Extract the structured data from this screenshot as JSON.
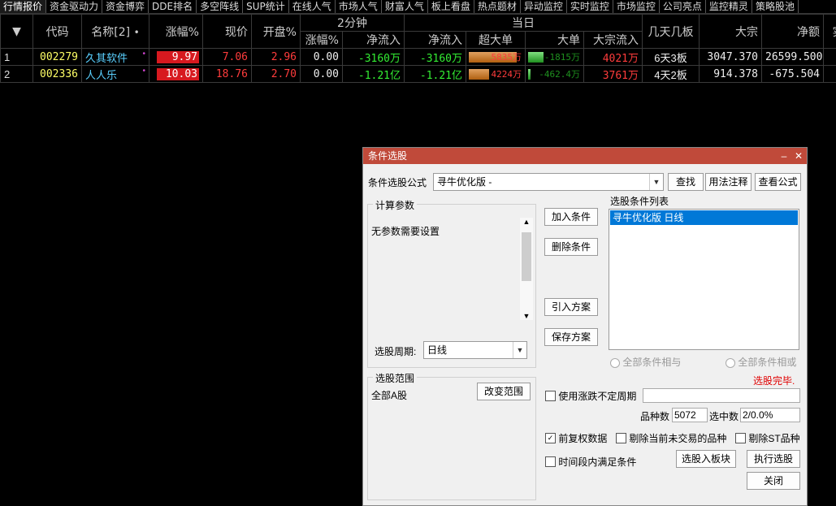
{
  "tabs": [
    "行情报价",
    "资金驱动力",
    "资金博弈",
    "DDE排名",
    "多空阵线",
    "SUP统计",
    "在线人气",
    "市场人气",
    "财富人气",
    "板上看盘",
    "热点题材",
    "异动监控",
    "实时监控",
    "市场监控",
    "公司亮点",
    "监控精灵",
    "策略股池"
  ],
  "header": {
    "code": "代码",
    "name": "名称[2]",
    "change_pct": "涨幅%",
    "price": "现价",
    "open_pct": "开盘%",
    "two_min": "2分钟",
    "two_min_change": "涨幅%",
    "two_min_inflow": "净流入",
    "today": "当日",
    "today_inflow": "净流入",
    "super_large": "超大单",
    "large": "大单",
    "bulk_inflow": "大宗流入",
    "boards": "几天几板",
    "block": "大宗",
    "net_amount": "净额",
    "extra": "实"
  },
  "rows": [
    {
      "idx": "1",
      "code": "002279",
      "name": "久其软件",
      "change": "9.97",
      "price": "7.06",
      "open": "2.96",
      "m2chg": "0.00",
      "m2in": "-3160万",
      "din": "-3160万",
      "super": "5835万",
      "super_ratio": 0.95,
      "large": "-1815万",
      "large_ratio": 0.3,
      "bulk": "4021万",
      "boards": "6天3板",
      "block": "3047.370",
      "net": "26599.500"
    },
    {
      "idx": "2",
      "code": "002336",
      "name": "人人乐",
      "change": "10.03",
      "price": "18.76",
      "open": "2.70",
      "m2chg": "0.00",
      "m2in": "-1.21亿",
      "din": "-1.21亿",
      "super": "4224万",
      "super_ratio": 0.4,
      "large": "-462.4万",
      "large_ratio": 0.05,
      "bulk": "3761万",
      "boards": "4天2板",
      "block": "914.378",
      "net": "-675.504"
    }
  ],
  "dialog": {
    "title": "条件选股",
    "formula_label": "条件选股公式",
    "formula_value": "寻牛优化版  -",
    "btn_find": "查找",
    "btn_usage": "用法注释",
    "btn_view": "查看公式",
    "params_caption": "计算参数",
    "params_text": "无参数需要设置",
    "period_label": "选股周期:",
    "period_value": "日线",
    "btn_add": "加入条件",
    "btn_delete": "删除条件",
    "btn_import": "引入方案",
    "btn_save": "保存方案",
    "list_caption": "选股条件列表",
    "list_item": "寻牛优化版  日线",
    "radio_and": "全部条件相与",
    "radio_or": "全部条件相或",
    "status": "选股完毕.",
    "scope_caption": "选股范围",
    "scope_value": "全部A股",
    "btn_scope": "改变范围",
    "use_uncertain": "使用涨跌不定周期",
    "count_label": "品种数",
    "count_value": "5072",
    "selected_label": "选中数",
    "selected_value": "2/0.0%",
    "cb_adjusted": "前复权数据",
    "cb_exclude_untraded": "剔除当前未交易的品种",
    "cb_exclude_st": "剔除ST品种",
    "cb_period": "时间段内满足条件",
    "btn_to_block": "选股入板块",
    "btn_execute": "执行选股",
    "btn_close": "关闭"
  },
  "colors": {
    "up": "#ff3c3c",
    "down": "#33ee33",
    "code": "#ffff66",
    "name": "#5ad0ff",
    "title_bar": "#c04a3a",
    "selected": "#0078d7"
  }
}
